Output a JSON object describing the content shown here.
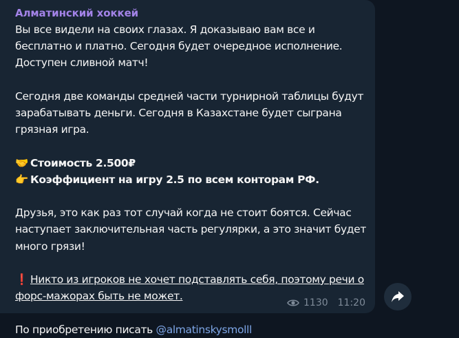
{
  "message": {
    "sender": "Алматинский хоккей",
    "paragraphs": {
      "p1": [
        "Вы все видели на своих глазах. Я доказываю вам все и",
        "бесплатно и платно. Сегодня будет очередное исполнение.",
        "Доступен сливной матч!"
      ],
      "p2": [
        "Сегодня две команды средней части турнирной таблицы будут",
        "зарабатывать деньги. Сегодня в Казахстане будет сыграна",
        "грязная игра."
      ],
      "price": {
        "emoji": "🤝",
        "text": "Стоимость 2.500₽"
      },
      "odds": {
        "emoji": "👉",
        "text": "Коэффициент на игру 2.5 по всем конторам РФ."
      },
      "p3": [
        "Друзья, это как раз тот случай когда не стоит боятся. Сейчас",
        "наступает заключительная часть регулярки, а это значит будет",
        "много грязи!"
      ],
      "warning": {
        "emoji": "❗",
        "line1": "Никто из игроков не хочет подставлять себя, поэтому речи о",
        "line2": "форс-мажорах быть не может."
      },
      "contact": {
        "text": "По приобретению писать ",
        "mention": "@almatinskysmolll"
      }
    },
    "views": "1130",
    "time": "11:20"
  },
  "colors": {
    "background": "#0e1621",
    "bubble": "#182533",
    "sender": "#a383e8",
    "mention": "#7ea6e6",
    "meta": "#7f8b99"
  },
  "icons": [
    "eye-icon",
    "share-icon"
  ]
}
